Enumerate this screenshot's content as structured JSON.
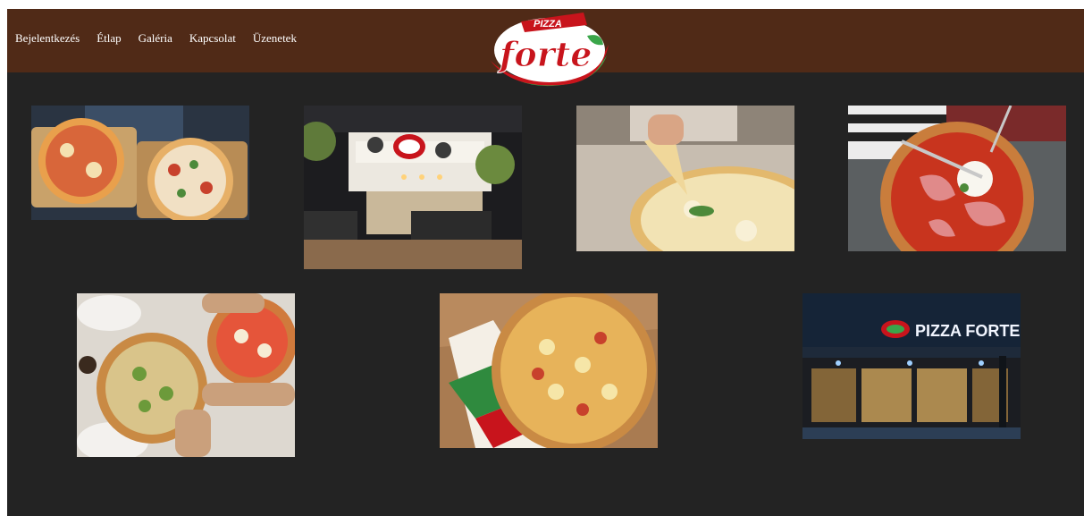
{
  "nav": {
    "items": [
      {
        "label": "Bejelentkezés"
      },
      {
        "label": "Étlap"
      },
      {
        "label": "Galéria"
      },
      {
        "label": "Kapcsolat"
      },
      {
        "label": "Üzenetek"
      }
    ]
  },
  "logo": {
    "top_text": "PIZZA",
    "main_text": "forte"
  },
  "gallery": {
    "photos": [
      {
        "subject": "two pizzas in boxes held by a person"
      },
      {
        "subject": "Pizza Forte restaurant interior"
      },
      {
        "subject": "hands lifting a slice of white pizza"
      },
      {
        "subject": "prosciutto burrata pizza being cut"
      },
      {
        "subject": "hands reaching for shared pizzas"
      },
      {
        "subject": "pizza with chicken and pineapple in a box"
      },
      {
        "subject": "Pizza Forte storefront at night",
        "sign_text": "PIZZA FORTE"
      }
    ]
  },
  "colors": {
    "navbar": "#502a17",
    "page_background": "#232323",
    "nav_text": "#ffffff",
    "logo_red": "#c8141c",
    "logo_green": "#3aa64a"
  }
}
